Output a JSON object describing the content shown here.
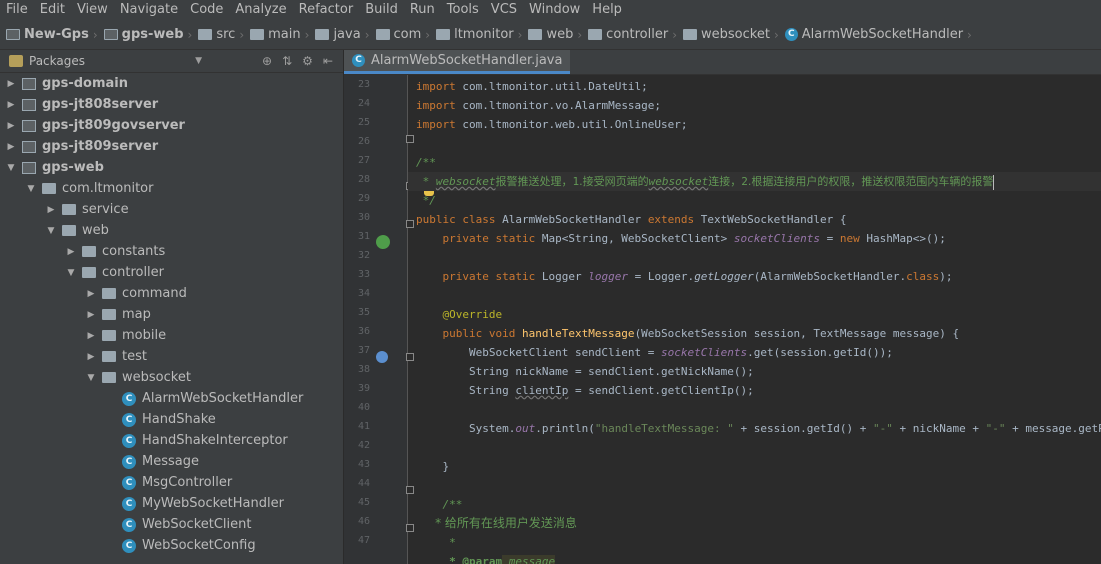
{
  "menu": [
    "File",
    "Edit",
    "View",
    "Navigate",
    "Code",
    "Analyze",
    "Refactor",
    "Build",
    "Run",
    "Tools",
    "VCS",
    "Window",
    "Help"
  ],
  "breadcrumbs": [
    {
      "label": "New-Gps",
      "icon": "module-icon",
      "bold": true
    },
    {
      "label": "gps-web",
      "icon": "module-icon",
      "bold": true
    },
    {
      "label": "src",
      "icon": "folder-icon"
    },
    {
      "label": "main",
      "icon": "folder-icon"
    },
    {
      "label": "java",
      "icon": "folder-icon"
    },
    {
      "label": "com",
      "icon": "folder-icon"
    },
    {
      "label": "ltmonitor",
      "icon": "folder-icon"
    },
    {
      "label": "web",
      "icon": "folder-icon"
    },
    {
      "label": "controller",
      "icon": "folder-icon"
    },
    {
      "label": "websocket",
      "icon": "folder-icon"
    },
    {
      "label": "AlarmWebSocketHandler",
      "icon": "class-icon"
    }
  ],
  "project_panel": {
    "view_label": "Packages",
    "tree": [
      {
        "label": "gps-domain",
        "depth": 0,
        "type": "module",
        "arrow": "▶"
      },
      {
        "label": "gps-jt808server",
        "depth": 0,
        "type": "module",
        "arrow": "▶"
      },
      {
        "label": "gps-jt809govserver",
        "depth": 0,
        "type": "module",
        "arrow": "▶"
      },
      {
        "label": "gps-jt809server",
        "depth": 0,
        "type": "module",
        "arrow": "▶"
      },
      {
        "label": "gps-web",
        "depth": 0,
        "type": "module",
        "arrow": "▼"
      },
      {
        "label": "com.ltmonitor",
        "depth": 1,
        "type": "package",
        "arrow": "▼"
      },
      {
        "label": "service",
        "depth": 2,
        "type": "package",
        "arrow": "▶"
      },
      {
        "label": "web",
        "depth": 2,
        "type": "package",
        "arrow": "▼"
      },
      {
        "label": "constants",
        "depth": 3,
        "type": "package",
        "arrow": "▶"
      },
      {
        "label": "controller",
        "depth": 3,
        "type": "package",
        "arrow": "▼"
      },
      {
        "label": "command",
        "depth": 4,
        "type": "package",
        "arrow": "▶"
      },
      {
        "label": "map",
        "depth": 4,
        "type": "package",
        "arrow": "▶"
      },
      {
        "label": "mobile",
        "depth": 4,
        "type": "package",
        "arrow": "▶"
      },
      {
        "label": "test",
        "depth": 4,
        "type": "package",
        "arrow": "▶"
      },
      {
        "label": "websocket",
        "depth": 4,
        "type": "package",
        "arrow": "▼"
      },
      {
        "label": "AlarmWebSocketHandler",
        "depth": 5,
        "type": "class",
        "arrow": ""
      },
      {
        "label": "HandShake",
        "depth": 5,
        "type": "class",
        "arrow": ""
      },
      {
        "label": "HandShakeInterceptor",
        "depth": 5,
        "type": "class",
        "arrow": ""
      },
      {
        "label": "Message",
        "depth": 5,
        "type": "class",
        "arrow": ""
      },
      {
        "label": "MsgController",
        "depth": 5,
        "type": "class",
        "arrow": ""
      },
      {
        "label": "MyWebSocketHandler",
        "depth": 5,
        "type": "class",
        "arrow": ""
      },
      {
        "label": "WebSocketClient",
        "depth": 5,
        "type": "class",
        "arrow": ""
      },
      {
        "label": "WebSocketConfig",
        "depth": 5,
        "type": "class",
        "arrow": ""
      }
    ]
  },
  "editor": {
    "tab_label": "AlarmWebSocketHandler.java",
    "line_numbers": [
      "23",
      "24",
      "25",
      "26",
      "27",
      "28",
      "29",
      "30",
      "31",
      "32",
      "33",
      "34",
      "35",
      "36",
      "37",
      "38",
      "39",
      "40",
      "41",
      "42",
      "43",
      "44",
      "45",
      "46",
      "47"
    ],
    "lines": {
      "l23": {
        "kw": "import",
        "rest": " com.ltmonitor.util.DateUtil;"
      },
      "l24": {
        "kw": "import",
        "rest": " com.ltmonitor.vo.AlarmMessage;"
      },
      "l25": {
        "kw": "import",
        "rest": " com.ltmonitor.web.util.OnlineUser;"
      },
      "l27": "/**",
      "l28a": " * ",
      "l28b": "websocket",
      "l28c": "报警推送处理，",
      "l28d": "1",
      "l28e": ".接受网页端的",
      "l28f": "websocket",
      "l28g": "连接，",
      "l28h": "2",
      "l28i": ".根据连接用户的权限，推送权限范围内车辆的报警",
      "l29": " */",
      "l30": {
        "kw1": "public class",
        "cls": " AlarmWebSocketHandler ",
        "kw2": "extends",
        "rest": " TextWebSocketHandler {"
      },
      "l31": {
        "kw": "    private static",
        "t1": " Map<String, WebSocketClient> ",
        "fld": "socketClients",
        "t2": " = ",
        "kw2": "new",
        "t3": " HashMap<>();"
      },
      "l33": {
        "kw": "    private static",
        "t1": " Logger ",
        "fld": "logger",
        "t2": " = Logger.",
        "sm": "getLogger",
        "t3": "(AlarmWebSocketHandler.",
        "kw2": "class",
        "t4": ");"
      },
      "l35": "    @Override",
      "l36": {
        "kw": "    public void",
        "mth": " handleTextMessage",
        "rest": "(WebSocketSession session, TextMessage message) {"
      },
      "l37": {
        "t1": "        WebSocketClient sendClient = ",
        "fld": "socketClients",
        "t2": ".get(session.getId());"
      },
      "l38": "        String nickName = sendClient.getNickName();",
      "l39": {
        "t1": "        String ",
        "und": "clientIp",
        "t2": " = sendClient.getClientIp();"
      },
      "l41": {
        "t1": "        System.",
        "fld": "out",
        "t2": ".println(",
        "s1": "\"handleTextMessage: \"",
        "t3": " + session.getId() + ",
        "s2": "\"-\"",
        "t4": " + nickName + ",
        "s3": "\"-\"",
        "t5": " + message.getPayload());"
      },
      "l43": "    }",
      "l45": "    /**",
      "l46": "     * 给所有在线用户发送消息",
      "l47a": "     * ",
      "l47b": "     * @param",
      "l47c": " message"
    }
  },
  "colors": {
    "accent": "#4a88c7",
    "background": "#2b2b2b",
    "panel": "#3c3f41"
  }
}
